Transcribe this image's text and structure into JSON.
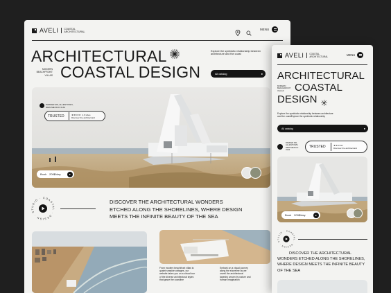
{
  "brand": {
    "name": "AVELI",
    "sub_line1": "COASTAL",
    "sub_line2": "ARCHITECTURAL"
  },
  "header": {
    "menu_label": "MENU"
  },
  "hero": {
    "title_line1": "ARCHITECTURAL",
    "title_line2": "COASTAL DESIGN",
    "tagline": [
      "MODERN",
      "BEACHFRONT",
      "VILLAS"
    ],
    "description": "Explore the symbiotic relationship between architecture and the coast",
    "catalog_label": "All catalog",
    "address": [
      "PARKER RD, ALLENTOWN,",
      "NEW MEXICO 3134"
    ],
    "trusted_label": "TRUSTED",
    "rating_stars": "★★★★★",
    "reviews": "4.6 vibes",
    "review_sub": "Discover the architectural",
    "book_label": "Book",
    "price": "200$/day"
  },
  "discover": {
    "text_line1": "DISCOVER THE ARCHITECTURAL WONDERS",
    "text_line2": "ETCHED ALONG THE SHORELINES, WHERE DESIGN",
    "text_line3": "MEETS THE INFINITE BEAUTY OF THE SEA",
    "badge_text": "COASTAL · DESIGN · STUDIO ·"
  },
  "cards": {
    "card1_text": [
      "From modern beachfront villas to",
      "quaint seaside cottages, our",
      "website takes you on a virtual tour",
      "of the diverse architectural styles",
      "that grace the coastline"
    ],
    "card2_text": [
      "Embark on a visual journey",
      "along the shoreline as we",
      "unveil the architectural",
      "tapestry woven by nature and",
      "human imagination"
    ]
  },
  "mobile": {
    "title_line1": "ARCHITECTURAL",
    "title_line2": "COASTAL",
    "title_line3": "DESIGN",
    "tagline": [
      "MODERN",
      "BEACHFRONT",
      "VILLAS"
    ],
    "description_line1": "Explore the symbiotic relationship between architecture",
    "description_line2": "and the coastExplore the symbiotic relationship",
    "catalog_label": "All catalog",
    "address": [
      "PARKER RD,",
      "ALLENTOWN,",
      "NEW MEXICO",
      "3134"
    ],
    "trusted_label": "TRUSTED",
    "review_sub": "Discover the architectural",
    "book_label": "Book",
    "price": "200$/day",
    "discover_line1": "DISCOVER THE ARCHITECTURAL",
    "discover_line2": "WONDERS ETCHED ALONG THE SHORELINES,",
    "discover_line3": "WHERE DESIGN MEETS THE INFINITE BEAUTY",
    "discover_line4": "OF THE SEA"
  },
  "colors": {
    "background": "#1f1f1f",
    "page": "#f3f3f1",
    "ink": "#141414",
    "sand": "#d9c3a0",
    "sea": "#9fb6c4"
  }
}
